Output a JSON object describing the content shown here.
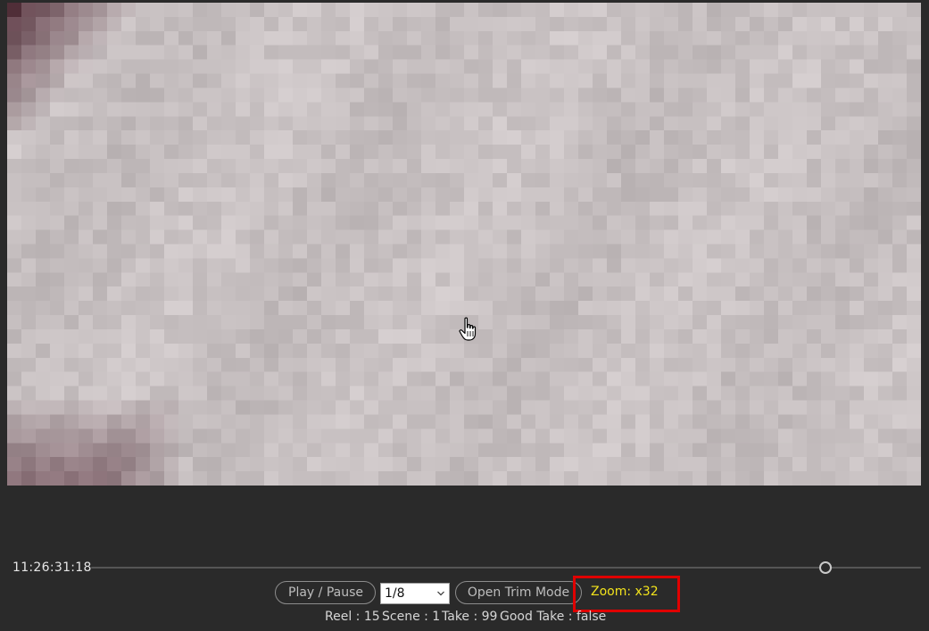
{
  "player": {
    "zoom_level": 32,
    "cursor": "hand-pointer-icon"
  },
  "timeline": {
    "timecode": "11:26:31:18",
    "position_fraction": 0.885
  },
  "controls": {
    "play_pause_label": "Play / Pause",
    "speed_selected": "1/8",
    "speed_select_icon": "chevron-down-icon",
    "open_trim_label": "Open Trim Mode",
    "zoom_label": "Zoom: x32"
  },
  "metadata": {
    "reel": "Reel : 15",
    "scene": "Scene : 1",
    "take": "Take : 99",
    "good_take": "Good Take : false"
  },
  "colors": {
    "background": "#2a2a2a",
    "zoom_text": "#f2e31c",
    "highlight_border": "#e00000",
    "button_border": "#8c8c8c"
  }
}
